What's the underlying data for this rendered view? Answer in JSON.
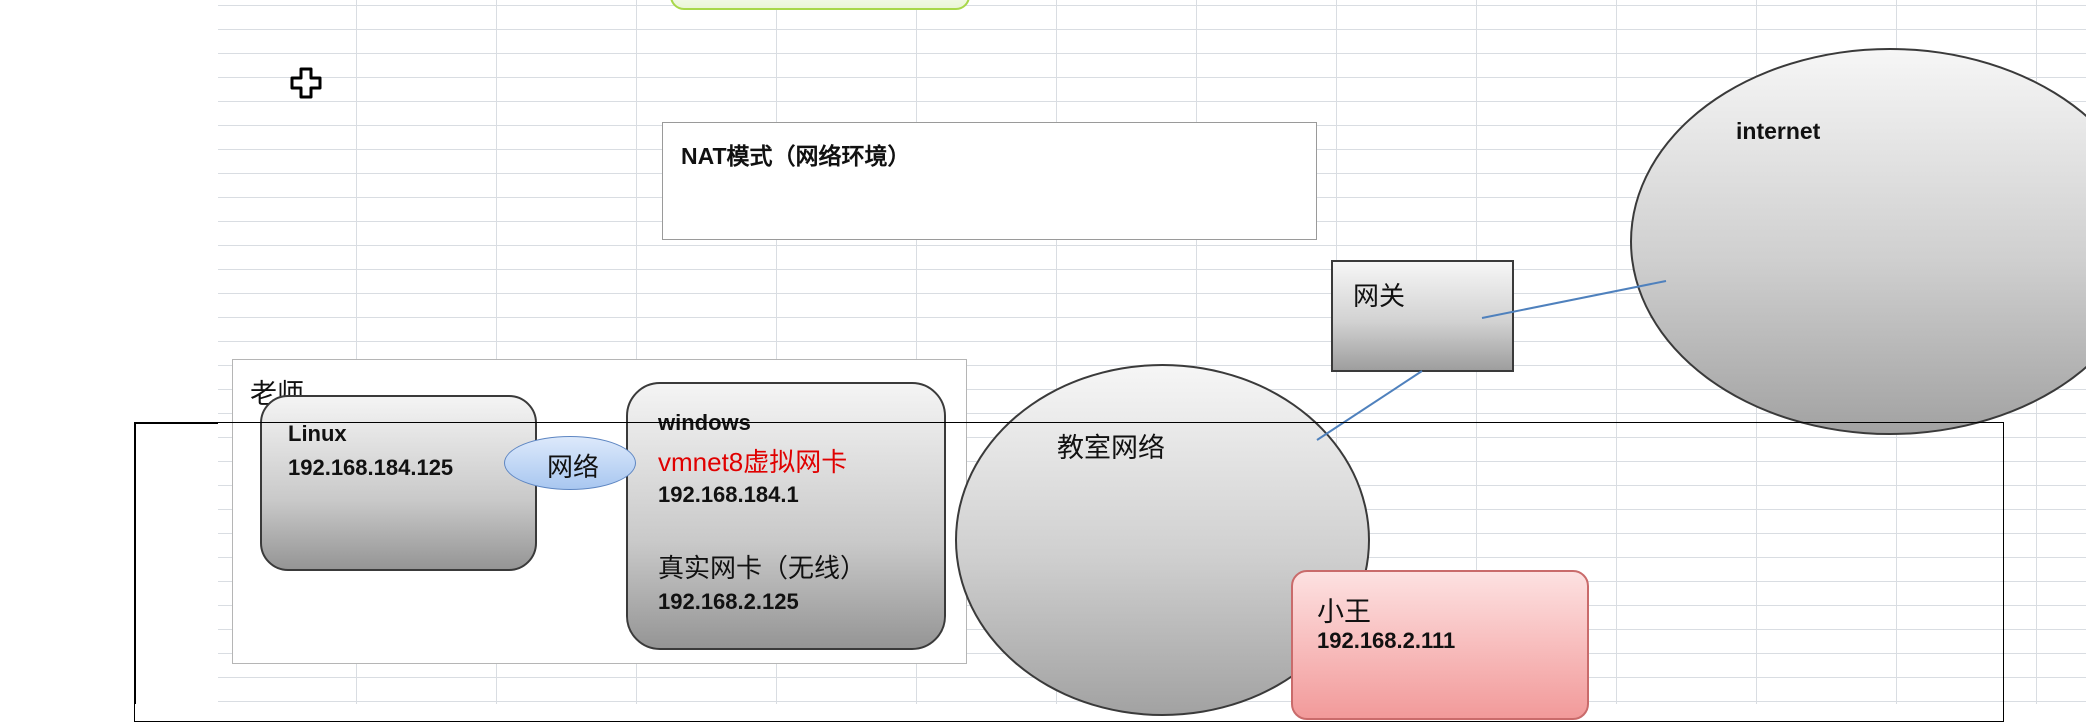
{
  "diagram": {
    "nat_box": {
      "title": "NAT模式（网络环境）"
    },
    "internet": {
      "label": "internet"
    },
    "gateway": {
      "label": "网关"
    },
    "teacher": {
      "label": "老师"
    },
    "linux": {
      "name": "Linux",
      "ip": "192.168.184.125"
    },
    "network_oval": {
      "label": "网络"
    },
    "windows": {
      "name": "windows",
      "vmnet_label": "vmnet8虚拟网卡",
      "vmnet_ip": "192.168.184.1",
      "real_nic_label": "真实网卡（无线）",
      "real_nic_ip": "192.168.2.125"
    },
    "classroom": {
      "label": "教室网络"
    },
    "xiaowang": {
      "name": "小王",
      "ip": "192.168.2.111"
    }
  },
  "colors": {
    "accent_red": "#e00000",
    "gridline": "#d9dde2",
    "oval_blue": "#a9c7f0",
    "pink_box": "#f29a9a",
    "connector": "#4f81bd",
    "top_green": "#a8d84a"
  },
  "icons": {
    "cursor": "move-cursor-icon"
  }
}
